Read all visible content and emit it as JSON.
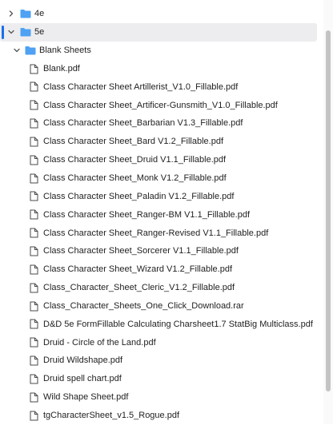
{
  "tree": {
    "folder_4e": {
      "label": "4e",
      "expanded": false
    },
    "folder_5e": {
      "label": "5e",
      "expanded": true,
      "selected": true
    },
    "folder_blank_sheets": {
      "label": "Blank Sheets",
      "expanded": true,
      "files": [
        "Blank.pdf",
        "Class Character Sheet Artillerist_V1.0_Fillable.pdf",
        "Class Character Sheet_Artificer-Gunsmith_V1.0_Fillable.pdf",
        "Class Character Sheet_Barbarian V1.3_Fillable.pdf",
        "Class Character Sheet_Bard V1.2_Fillable.pdf",
        "Class Character Sheet_Druid V1.1_Fillable.pdf",
        "Class Character Sheet_Monk V1.2_Fillable.pdf",
        "Class Character Sheet_Paladin V1.2_Fillable.pdf",
        "Class Character Sheet_Ranger-BM V1.1_Fillable.pdf",
        "Class Character Sheet_Ranger-Revised V1.1_Fillable.pdf",
        "Class Character Sheet_Sorcerer V1.1_Fillable.pdf",
        "Class Character Sheet_Wizard V1.2_Fillable.pdf",
        "Class_Character_Sheet_Cleric_V1.2_Fillable.pdf",
        "Class_Character_Sheets_One_Click_Download.rar",
        "D&D 5e FormFillable Calculating Charsheet1.7 StatBig Multiclass.pdf",
        "Druid - Circle of the Land.pdf",
        "Druid Wildshape.pdf",
        "Druid spell chart.pdf",
        "Wild Shape Sheet.pdf",
        "tgCharacterSheet_v1.5_Rogue.pdf"
      ]
    }
  },
  "colors": {
    "folder": "#4ea1f3",
    "accent": "#1a6fe8",
    "selected_bg": "#ededf0"
  },
  "icons": {
    "collapsed": "chevron-right-icon",
    "expanded": "chevron-down-icon",
    "folder": "folder-icon",
    "file": "file-icon"
  }
}
